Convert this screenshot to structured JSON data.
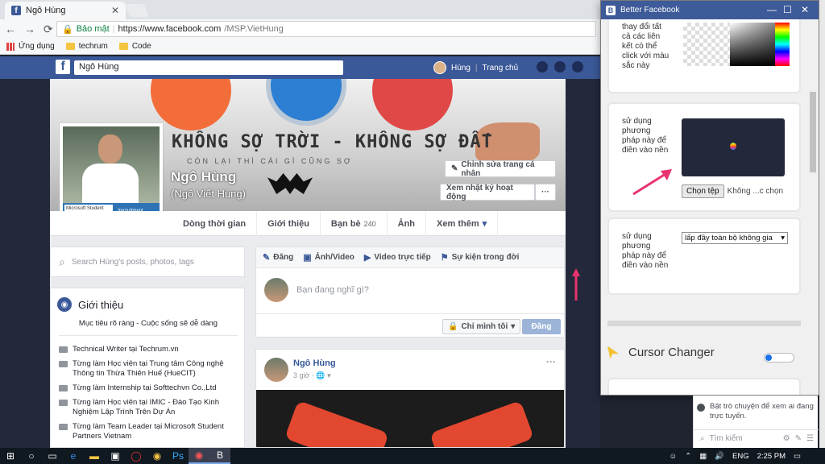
{
  "browser": {
    "tab_title": "Ngô Hùng",
    "tab_close": "✕",
    "secure_label": "Bảo mật",
    "url_host": "https://www.facebook.com",
    "url_path": "/MSP.VietHung",
    "nav_icons": [
      "back-icon",
      "forward-icon",
      "reload-icon"
    ],
    "bookmarks": [
      "Ứng dụng",
      "techrum",
      "Code"
    ]
  },
  "facebook": {
    "search_value": "Ngô Hùng",
    "user_short": "Hùng",
    "home_label": "Trang chủ",
    "profile": {
      "slogan": "KHÔNG SỢ TRỜI - KHÔNG SỢ ĐẤT",
      "slogan_sub": "CÒN LẠI THÌ CÁI GÌ CŨNG SỢ",
      "name": "Ngô Hùng",
      "alt_name": "(Ngô Viết Hùng)",
      "badge_ms": "Microsoft Student Partners",
      "badge_rec": "/recruitment",
      "edit_button": "Chỉnh sửa trang cá nhân",
      "activity_button": "Xem nhật ký hoạt động",
      "more_button": "···"
    },
    "tabs": [
      {
        "label": "Dòng thời gian"
      },
      {
        "label": "Giới thiệu"
      },
      {
        "label": "Bạn bè",
        "count": "240"
      },
      {
        "label": "Ảnh"
      },
      {
        "label": "Xem thêm",
        "caret": "▾"
      }
    ],
    "left": {
      "search_placeholder": "Search Hùng's posts, photos, tags",
      "intro_title": "Giới thiệu",
      "motto": "Mục tiêu rõ ràng - Cuộc sống sẽ dễ dàng",
      "work": [
        "Technical Writer tại Techrum.vn",
        "Từng làm Học viên tại Trung tâm Công nghệ Thông tin Thừa Thiên Huế (HueCIT)",
        "Từng làm Internship tại Softtechvn Co.,Ltd",
        "Từng làm Học viên tại IMIC - Đào Tạo Kinh Nghiệm Lập Trình Trên Dự Án",
        "Từng làm Team Leader tại Microsoft Student Partners Vietnam"
      ]
    },
    "composer": {
      "tabs": [
        "Đăng",
        "Ảnh/Video",
        "Video trực tiếp",
        "Sự kiện trong đời"
      ],
      "placeholder": "Bạn đang nghĩ gì?",
      "privacy": "Chỉ mình tôi",
      "post_button": "Đăng"
    },
    "post": {
      "author": "Ngô Hùng",
      "time": "3 giờ · 🌐 ▾",
      "more": "···"
    },
    "chat": {
      "message": "Bật trò chuyện để xem ai đang trực tuyến.",
      "search_placeholder": "Tìm kiếm"
    }
  },
  "extension": {
    "title": "Better Facebook",
    "controls": [
      "—",
      "☐",
      "✕"
    ],
    "card1_text": "thay đổi tất cả các liên kết có thể click với màu sắc này",
    "card2_text": "sử dụng phương pháp này để điền vào nền",
    "choose_file": "Chọn tệp",
    "no_file": "Không ...c chọn",
    "card3_text": "sử dụng phương pháp này để điền vào nền",
    "fill_option": "lấp đầy toàn bộ không gia",
    "cursor_label": "Cursor Changer",
    "toggle_on": true
  },
  "taskbar": {
    "language": "ENG",
    "time": "2:25 PM",
    "accent": "#7aa7e8"
  },
  "colors": {
    "facebook_blue": "#3b5998",
    "extension_title": "#3d5a99",
    "arrow_pink": "#e8336f"
  }
}
